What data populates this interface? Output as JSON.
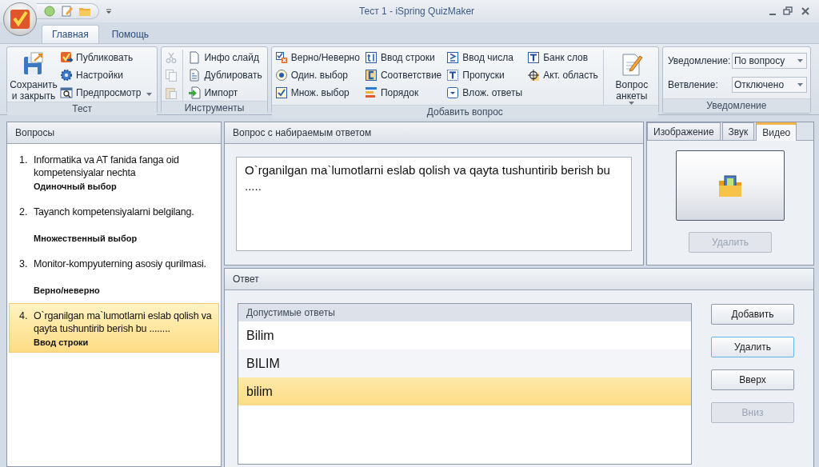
{
  "window": {
    "title": "Тест 1 - iSpring QuizMaker"
  },
  "ribbon_tabs": [
    {
      "label": "Главная",
      "selected": true
    },
    {
      "label": "Помощь",
      "selected": false
    }
  ],
  "ribbon_groups": [
    {
      "kind": "buttons",
      "title": "Тест",
      "columns": [
        {
          "divider": false,
          "items": [
            {
              "kind": "large",
              "label": "Сохранить и закрыть",
              "dropdown": false,
              "disabled": false
            }
          ]
        },
        {
          "divider": false,
          "items": [
            {
              "kind": "small",
              "label": "Публиковать",
              "dropdown": false,
              "disabled": false
            },
            {
              "kind": "small",
              "label": "Настройки",
              "dropdown": false,
              "disabled": false
            },
            {
              "kind": "small",
              "label": "Предпросмотр",
              "dropdown": true,
              "disabled": false
            }
          ]
        }
      ]
    },
    {
      "kind": "buttons",
      "title": "Инструменты",
      "columns": [
        {
          "divider": false,
          "items": [
            {
              "kind": "icon",
              "dropdown": false,
              "disabled": true
            },
            {
              "kind": "icon",
              "dropdown": false,
              "disabled": true
            },
            {
              "kind": "icon",
              "dropdown": false,
              "disabled": true
            }
          ]
        },
        {
          "divider": true,
          "items": [
            {
              "kind": "small",
              "label": "Инфо слайд",
              "dropdown": false,
              "disabled": false
            },
            {
              "kind": "small",
              "label": "Дублировать",
              "dropdown": false,
              "disabled": false
            },
            {
              "kind": "small",
              "label": "Импорт",
              "dropdown": false,
              "disabled": false
            }
          ]
        }
      ]
    },
    {
      "kind": "buttons",
      "title": "Добавить вопрос",
      "columns": [
        {
          "divider": false,
          "items": [
            {
              "kind": "small",
              "label": "Верно/Неверно",
              "dropdown": false,
              "disabled": false
            },
            {
              "kind": "small",
              "label": "Один. выбор",
              "dropdown": false,
              "disabled": false
            },
            {
              "kind": "small",
              "label": "Множ. выбор",
              "dropdown": false,
              "disabled": false
            }
          ]
        },
        {
          "divider": false,
          "items": [
            {
              "kind": "small",
              "label": "Ввод строки",
              "dropdown": false,
              "disabled": false
            },
            {
              "kind": "small",
              "label": "Соответствие",
              "dropdown": false,
              "disabled": false
            },
            {
              "kind": "small",
              "label": "Порядок",
              "dropdown": false,
              "disabled": false
            }
          ]
        },
        {
          "divider": false,
          "items": [
            {
              "kind": "small",
              "label": "Ввод числа",
              "dropdown": false,
              "disabled": false
            },
            {
              "kind": "small",
              "label": "Пропуски",
              "dropdown": false,
              "disabled": false
            },
            {
              "kind": "small",
              "label": "Влож. ответы",
              "dropdown": false,
              "disabled": false
            }
          ]
        },
        {
          "divider": false,
          "items": [
            {
              "kind": "small",
              "label": "Банк слов",
              "dropdown": false,
              "disabled": false
            },
            {
              "kind": "small",
              "label": "Акт. область",
              "dropdown": false,
              "disabled": false
            }
          ]
        },
        {
          "divider": true,
          "items": [
            {
              "kind": "large",
              "label": "Вопрос анкеты",
              "dropdown": true,
              "disabled": false
            }
          ]
        }
      ]
    },
    {
      "kind": "fields",
      "title": "Уведомление",
      "fields": [
        {
          "label": "Уведомление:",
          "value": "По вопросу"
        },
        {
          "label": "Ветвление:",
          "value": "Отключено"
        }
      ]
    }
  ],
  "questions_panel": {
    "title": "Вопросы",
    "questions": [
      {
        "number": "1.",
        "text": "Informatika va AT fanida fanga oid kompetensiyalar nechta",
        "type": "Одиночный выбор",
        "selected": false
      },
      {
        "number": "2.",
        "text": "Tayanch kompetensiyalarni belgilang.",
        "type": "Множественный выбор",
        "selected": false
      },
      {
        "number": "3.",
        "text": "Monitor-kompyuterning asosiy qurilmasi.",
        "type": "Верно/неверно",
        "selected": false
      },
      {
        "number": "4.",
        "text": "O`rganilgan ma`lumotlarni eslab qolish va qayta tushuntirib berish bu ........",
        "type": "Ввод строки",
        "selected": true
      }
    ]
  },
  "question_panel": {
    "title": "Вопрос с набираемым ответом",
    "text": "O`rganilgan ma`lumotlarni eslab qolish va qayta tushuntirib berish bu ....."
  },
  "media_panel": {
    "tabs": [
      {
        "label": "Изображение",
        "selected": false
      },
      {
        "label": "Звук",
        "selected": false
      },
      {
        "label": "Видео",
        "selected": true
      }
    ],
    "delete_button": {
      "label": "Удалить",
      "disabled": true
    }
  },
  "answer_panel": {
    "title": "Ответ",
    "list_header": "Допустимые ответы",
    "answers": [
      {
        "text": "Bilim",
        "selected": false
      },
      {
        "text": "BILIM",
        "selected": false
      },
      {
        "text": "bilim",
        "selected": true
      }
    ],
    "buttons": [
      {
        "label": "Добавить",
        "disabled": false,
        "focused": false
      },
      {
        "label": "Удалить",
        "disabled": false,
        "focused": true
      },
      {
        "label": "Вверх",
        "disabled": false,
        "focused": false
      },
      {
        "label": "Вниз",
        "disabled": true,
        "focused": false
      }
    ]
  }
}
